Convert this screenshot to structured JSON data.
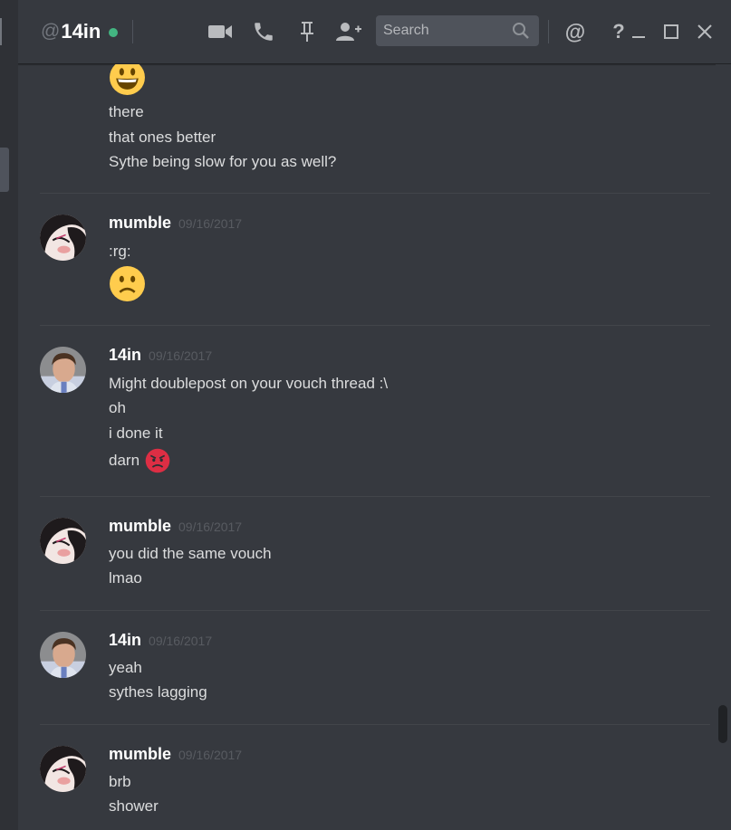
{
  "window": {
    "dm_prefix": "@",
    "dm_name": "14in",
    "status_color": "#43b581",
    "icons": [
      "video-call-icon",
      "voice-call-icon",
      "pin-icon",
      "add-friend-icon",
      "mention-icon",
      "help-icon",
      "minimize-icon",
      "maximize-icon",
      "close-icon"
    ]
  },
  "search": {
    "placeholder": "Search"
  },
  "help_label": "?",
  "mention_label": "@",
  "messages": [
    {
      "author": "",
      "timestamp": "",
      "lines": [
        "there",
        "that ones better",
        "Sythe being slow for you as well?"
      ],
      "emoji_top": "grinning-emoji"
    },
    {
      "author": "mumble",
      "timestamp": "09/16/2017",
      "lines": [
        ":rg:"
      ],
      "emoji_bottom": "frowning-emoji"
    },
    {
      "author": "14in",
      "timestamp": "09/16/2017",
      "lines": [
        "Might doublepost on your vouch thread :\\",
        "oh",
        "i done it",
        "darn"
      ],
      "inline_emoji": "angry-emoji"
    },
    {
      "author": "mumble",
      "timestamp": "09/16/2017",
      "lines": [
        "you did the same vouch",
        "lmao"
      ]
    },
    {
      "author": "14in",
      "timestamp": "09/16/2017",
      "lines": [
        "yeah",
        "sythes lagging"
      ]
    },
    {
      "author": "mumble",
      "timestamp": "09/16/2017",
      "lines": [
        "brb",
        "shower"
      ]
    }
  ],
  "colors": {
    "background": "#36393f",
    "text": "#dcddde",
    "author": "#ffffff",
    "timestamp": "#585b61",
    "search_bg": "#4f535b"
  }
}
